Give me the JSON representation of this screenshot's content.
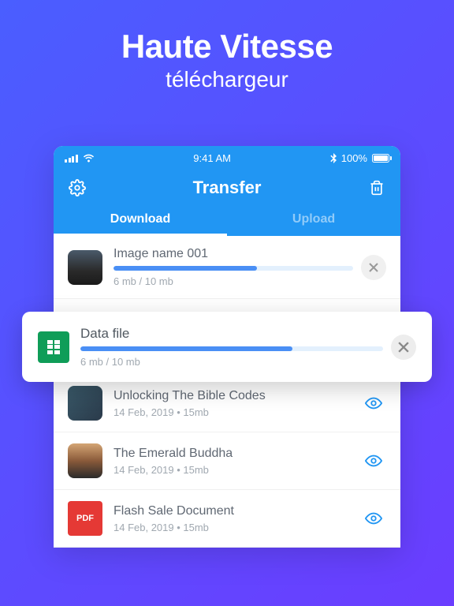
{
  "hero": {
    "title": "Haute Vitesse",
    "subtitle": "téléchargeur"
  },
  "statusbar": {
    "time": "9:41 AM",
    "battery": "100%"
  },
  "header": {
    "title": "Transfer"
  },
  "tabs": {
    "download": "Download",
    "upload": "Upload"
  },
  "items": [
    {
      "title": "Image name 001",
      "meta": "6 mb / 10 mb",
      "progress": 60,
      "type": "progress"
    },
    {
      "title": "Data file",
      "meta": "6 mb / 10 mb",
      "progress": 70,
      "type": "progress"
    },
    {
      "title": "Unlocking The Bible Codes",
      "meta": "14 Feb, 2019 • 15mb",
      "type": "done"
    },
    {
      "title": "The Emerald Buddha",
      "meta": "14 Feb, 2019 • 15mb",
      "type": "done"
    },
    {
      "title": "Flash Sale Document",
      "meta": "14 Feb, 2019 • 15mb",
      "type": "done"
    }
  ],
  "pdf_label": "PDF"
}
